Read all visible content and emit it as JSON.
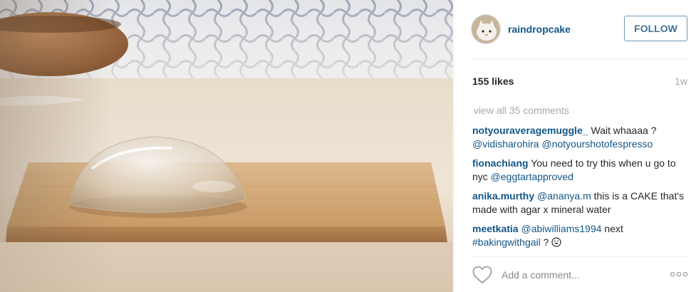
{
  "post": {
    "photo_description_icon": "raindrop-cake-photo",
    "author": {
      "username": "raindropcake",
      "avatar_icon": "raindrop-cake-avatar"
    },
    "follow_label": "FOLLOW",
    "likes": "155 likes",
    "age": "1w",
    "view_all_comments": "view all 35 comments",
    "comments": [
      {
        "user": "notyouraveragemuggle_",
        "parts": [
          {
            "text": " Wait whaaaa ?",
            "type": "text"
          },
          {
            "text": "@vidisharohira",
            "type": "tag"
          },
          {
            "text": " ",
            "type": "text"
          },
          {
            "text": "@notyourshotofespresso",
            "type": "tag"
          }
        ]
      },
      {
        "user": "fionachiang",
        "parts": [
          {
            "text": " You need to try this when u go to nyc ",
            "type": "text"
          },
          {
            "text": "@eggtartapproved",
            "type": "tag"
          }
        ]
      },
      {
        "user": "anika.murthy",
        "parts": [
          {
            "text": " ",
            "type": "text"
          },
          {
            "text": "@ananya.m",
            "type": "tag"
          },
          {
            "text": " this is a CAKE that's made with agar x mineral water",
            "type": "text"
          }
        ]
      },
      {
        "user": "meetkatia",
        "parts": [
          {
            "text": " ",
            "type": "text"
          },
          {
            "text": "@abiwilliams1994",
            "type": "tag"
          },
          {
            "text": " next ",
            "type": "text"
          },
          {
            "text": "#bakingwithgail",
            "type": "tag"
          },
          {
            "text": " ? ",
            "type": "text"
          },
          {
            "text": "grinning-emoji",
            "type": "emoji"
          }
        ]
      }
    ],
    "add_comment_placeholder": "Add a comment...",
    "like_icon": "heart-outline-icon",
    "more_icon": "more-options-icon"
  },
  "colors": {
    "username": "#125688",
    "follow_border": "#6f97b6",
    "follow_text": "#3f729b",
    "muted": "#a5a7aa"
  }
}
